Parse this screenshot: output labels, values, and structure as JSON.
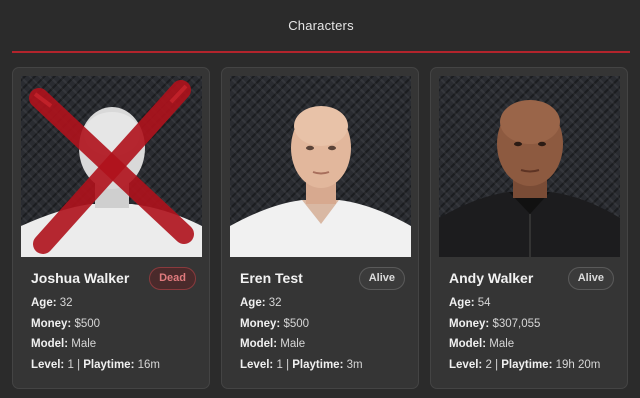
{
  "header": {
    "title": "Characters"
  },
  "colors": {
    "accent": "#b3242c",
    "dead_badge": "#e07a7d"
  },
  "labels": {
    "age": "Age:",
    "money": "Money:",
    "model": "Model:",
    "level": "Level:",
    "playtime": "Playtime:",
    "separator": "|"
  },
  "characters": [
    {
      "name": "Joshua Walker",
      "status": "Dead",
      "age": "32",
      "money": "$500",
      "model": "Male",
      "level": "1",
      "playtime": "16m",
      "portrait_icon": "character-portrait-crossed-out"
    },
    {
      "name": "Eren Test",
      "status": "Alive",
      "age": "32",
      "money": "$500",
      "model": "Male",
      "level": "1",
      "playtime": "3m",
      "portrait_icon": "character-portrait"
    },
    {
      "name": "Andy Walker",
      "status": "Alive",
      "age": "54",
      "money": "$307,055",
      "model": "Male",
      "level": "2",
      "playtime": "19h 20m",
      "portrait_icon": "character-portrait"
    }
  ]
}
